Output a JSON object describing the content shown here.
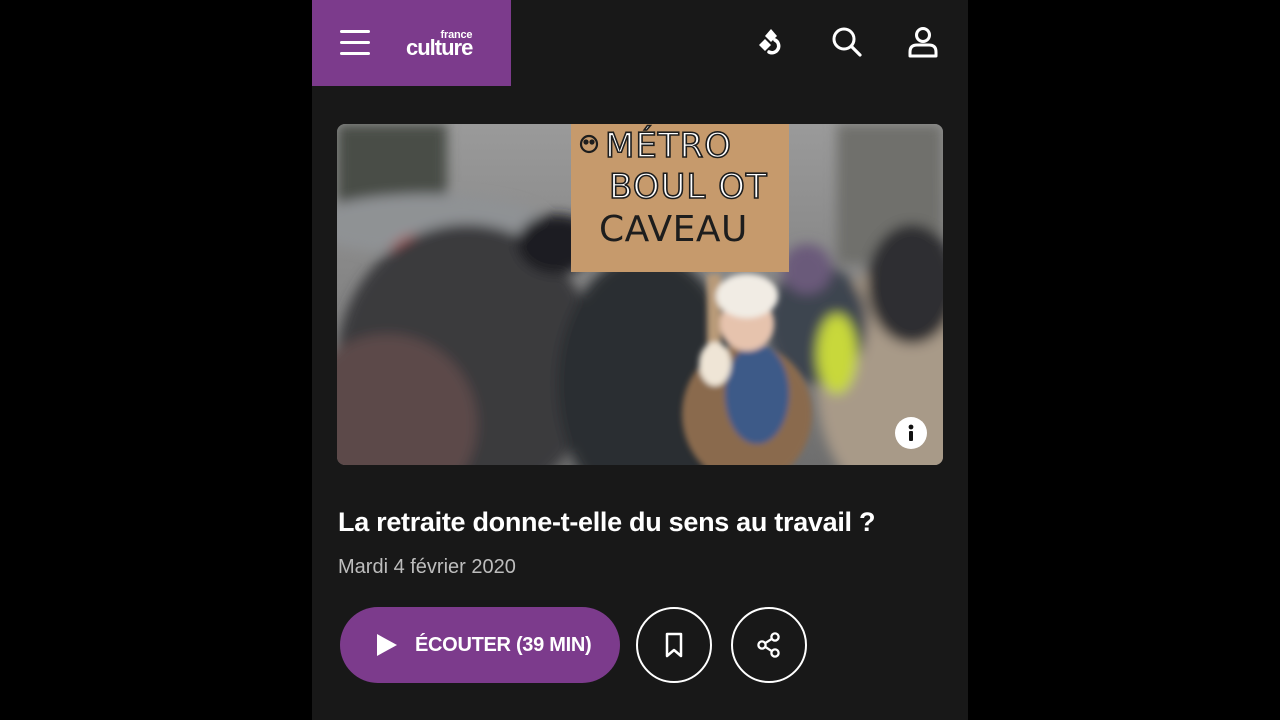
{
  "header": {
    "brand_small": "france",
    "brand_big": "culture",
    "icons": {
      "menu": "hamburger-menu-icon",
      "live": "radio-live-icon",
      "search": "search-icon",
      "account": "user-account-icon"
    }
  },
  "hero_image": {
    "sign_lines": [
      "MÉTRO",
      "BOUL OT",
      "CAVEAU"
    ],
    "info_icon": "info-icon"
  },
  "episode": {
    "title": "La retraite donne-t-elle du sens au travail ?",
    "date": "Mardi 4 février 2020"
  },
  "actions": {
    "listen_label": "ÉCOUTER (39 MIN)",
    "icons": {
      "play": "play-icon",
      "bookmark": "bookmark-icon",
      "share": "share-icon"
    }
  },
  "colors": {
    "accent": "#7c3b8c",
    "background": "#181818",
    "outer": "#000000",
    "text": "#ffffff",
    "muted_text": "#bdbdbd"
  }
}
